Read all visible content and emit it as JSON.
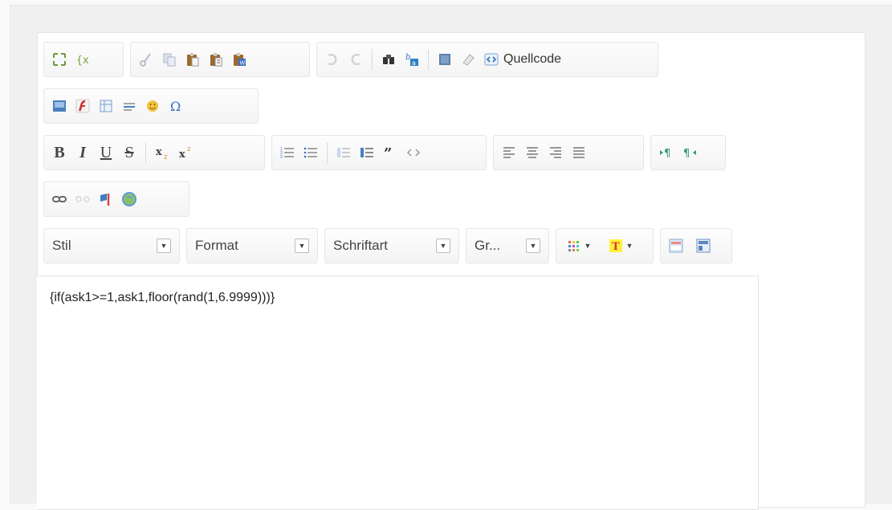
{
  "toolbar": {
    "row1": {
      "group_document": [
        "maximize-icon",
        "placeholder-icon"
      ],
      "group_clipboard": [
        "cut-icon",
        "copy-icon",
        "paste-icon",
        "paste-text-icon",
        "paste-word-icon"
      ],
      "group_editing": [
        "undo-icon",
        "redo-icon",
        "find-icon",
        "replace-icon",
        "select-all-icon",
        "remove-format-icon"
      ],
      "source_label": "Quellcode"
    },
    "row2": [
      "image-icon",
      "flash-icon",
      "table-icon",
      "horizontal-rule-icon",
      "smiley-icon",
      "special-char-icon"
    ],
    "row3": {
      "basic": [
        "bold-icon",
        "italic-icon",
        "underline-icon",
        "strike-icon",
        "subscript-icon",
        "superscript-icon"
      ],
      "lists": [
        "numbered-list-icon",
        "bulleted-list-icon",
        "outdent-icon",
        "indent-icon",
        "blockquote-icon",
        "code-icon"
      ],
      "align": [
        "align-left-icon",
        "align-center-icon",
        "align-right-icon",
        "align-justify-icon"
      ],
      "bidi": [
        "ltr-icon",
        "rtl-icon"
      ]
    },
    "row4": [
      "link-icon",
      "unlink-icon",
      "anchor-icon",
      "globe-icon"
    ],
    "row5": {
      "combos": [
        {
          "label": "Stil"
        },
        {
          "label": "Format"
        },
        {
          "label": "Schriftart"
        },
        {
          "label": "Gr..."
        }
      ],
      "colors": [
        "text-color-icon",
        "bg-color-icon"
      ],
      "tools": [
        "show-blocks-icon",
        "templates-icon"
      ]
    }
  },
  "editor": {
    "content": "{if(ask1>=1,ask1,floor(rand(1,6.9999)))}"
  }
}
